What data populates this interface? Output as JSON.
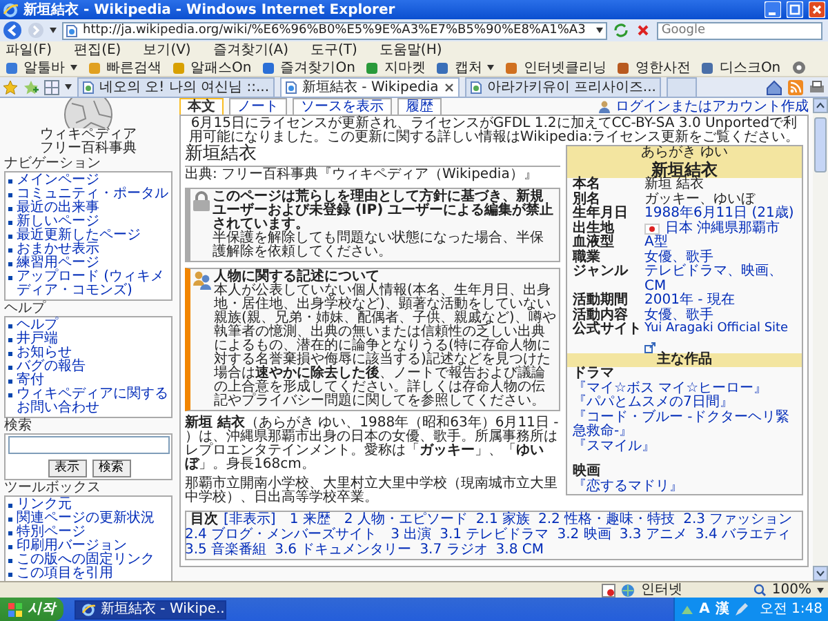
{
  "window": {
    "title": "新垣結衣 - Wikipedia - Windows Internet Explorer"
  },
  "address_bar": {
    "url": "http://ja.wikipedia.org/wiki/%E6%96%B0%E5%9E%A3%E7%B5%90%E8%A1%A3",
    "search_placeholder": "Google"
  },
  "menu": [
    "파일(F)",
    "편집(E)",
    "보기(V)",
    "즐겨찾기(A)",
    "도구(T)",
    "도움말(H)"
  ],
  "toolbar": [
    {
      "label": "알툴바",
      "dropdown": true
    },
    {
      "label": "빠른검색",
      "dropdown": false
    },
    {
      "label": "알패스On",
      "dropdown": false
    },
    {
      "label": "즐겨찾기On",
      "dropdown": false
    },
    {
      "label": "지마켓",
      "dropdown": false
    },
    {
      "label": "캡처",
      "dropdown": true
    },
    {
      "label": "인터넷클리닝",
      "dropdown": false
    },
    {
      "label": "영한사전",
      "dropdown": false
    },
    {
      "label": "디스크On",
      "dropdown": false
    }
  ],
  "tabs": [
    {
      "label": "네오의 오! 나의 여신님 ::...",
      "selected": false
    },
    {
      "label": "新垣結衣 - Wikipedia",
      "selected": true
    },
    {
      "label": "아라가키유이 프리사이즈...",
      "selected": false
    }
  ],
  "sidebar": {
    "logo_title": "ウィキペディア",
    "logo_subtitle": "フリー百科事典",
    "sections": [
      {
        "kind": "links",
        "heading": "ナビゲーション",
        "items": [
          "メインページ",
          "コミュニティ・ポータル",
          "最近の出来事",
          "新しいページ",
          "最近更新したページ",
          "おまかせ表示",
          "練習用ページ",
          "アップロード (ウィキメディア・コモンズ)"
        ]
      },
      {
        "kind": "links",
        "heading": "ヘルプ",
        "items": [
          "ヘルプ",
          "井戸端",
          "お知らせ",
          "バグの報告",
          "寄付",
          "ウィキペディアに関するお問い合わせ"
        ]
      },
      {
        "kind": "search",
        "heading": "検索",
        "buttons": [
          "表示",
          "検索"
        ]
      },
      {
        "kind": "links",
        "heading": "ツールボックス",
        "items": [
          "リンク元",
          "関連ページの更新状況",
          "特別ページ",
          "印刷用バージョン",
          "この版への固定リンク",
          "この項目を引用"
        ]
      }
    ]
  },
  "page": {
    "user_link": "ログインまたはアカウント作成",
    "page_tabs": [
      {
        "label": "本文",
        "selected": true
      },
      {
        "label": "ノート",
        "selected": false
      },
      {
        "label": "ソースを表示",
        "selected": false
      },
      {
        "label": "履歴",
        "selected": false
      }
    ],
    "site_notice": "6月15日にライセンスが更新され、ライセンスがGFDL 1.2に加えてCC-BY-SA 3.0 Unportedで利用可能になりました。この更新に関する詳しい情報はWikipedia:ライセンス更新をご覧ください。",
    "title": "新垣結衣",
    "subtitle": "出典: フリー百科事典『ウィキペディア（Wikipedia）』",
    "notices": [
      {
        "kind": "lock",
        "lines": [
          "**このページは荒らしを理由として方針に基づき、新規ユーザーおよび未登録 (IP) ユーザーによる編集が禁止されています。**",
          "半保護を解除しても問題ない状態になった場合、半保護解除を依頼してください。"
        ]
      },
      {
        "kind": "people",
        "lines": [
          "**人物に関する記述について**",
          "本人が公表していない個人情報(本名、生年月日、出身地・居住地、出身学校など)、顕著な活動をしていない親族(親、兄弟・姉妹、配偶者、子供、親戚など)、噂や執筆者の憶測、出典の無いまたは信頼性の乏しい出典によるもの、潜在的に論争となりうる(特に存命人物に対する名誉棄損や侮辱に該当する)記述などを見つけた場合は**速やかに除去した後**、ノートで報告および議論の上合意を形成してください。詳しくは存命人物の伝記やプライバシー問題に関してを参照してください。"
        ]
      }
    ],
    "paragraphs": [
      "**新垣 結衣**（あらがき ゆい、1988年（昭和63年）6月11日 - ）は、沖縄県那覇市出身の日本の女優、歌手。所属事務所はレプロエンタテインメント。愛称は「**ガッキー**」、「**ゆいぼ**」。身長168cm。",
      "那覇市立開南小学校、大里村立大里中学校（現南城市立大里中学校）、日出高等学校卒業。"
    ],
    "toc": {
      "title": "目次",
      "toggle": "[非表示]",
      "entries": [
        {
          "number": "1",
          "text": "来歴"
        },
        {
          "number": "2",
          "text": "人物・エピソード",
          "children": [
            {
              "number": "2.1",
              "text": "家族"
            },
            {
              "number": "2.2",
              "text": "性格・趣味・特技"
            },
            {
              "number": "2.3",
              "text": "ファッション"
            },
            {
              "number": "2.4",
              "text": "ブログ・メンバーズサイト"
            }
          ]
        },
        {
          "number": "3",
          "text": "出演",
          "children": [
            {
              "number": "3.1",
              "text": "テレビドラマ"
            },
            {
              "number": "3.2",
              "text": "映画"
            },
            {
              "number": "3.3",
              "text": "アニメ"
            },
            {
              "number": "3.4",
              "text": "バラエティ"
            },
            {
              "number": "3.5",
              "text": "音楽番組"
            },
            {
              "number": "3.6",
              "text": "ドキュメンタリー"
            },
            {
              "number": "3.7",
              "text": "ラジオ"
            },
            {
              "number": "3.8",
              "text": "CM"
            }
          ]
        }
      ]
    },
    "infobox": {
      "ruby": "あらがき ゆい",
      "name": "新垣結衣",
      "rows": [
        {
          "kind": "text",
          "label": "本名",
          "value": "新垣 結衣",
          "link": false
        },
        {
          "kind": "text",
          "label": "別名",
          "value": "ガッキー、ゆいぼ",
          "link": false
        },
        {
          "kind": "text",
          "label": "生年月日",
          "value": "1988年6月11日 (21歳)",
          "link": true
        },
        {
          "kind": "flag",
          "label": "出生地",
          "value": "日本 沖縄県那覇市",
          "link": true
        },
        {
          "kind": "text",
          "label": "血液型",
          "value": "A型",
          "link": true
        },
        {
          "kind": "text",
          "label": "職業",
          "value": "女優、歌手",
          "link": true
        },
        {
          "kind": "text",
          "label": "ジャンル",
          "value": "テレビドラマ、映画、CM",
          "link": true
        },
        {
          "kind": "text",
          "label": "活動期間",
          "value": "2001年 - 現在",
          "link": true
        },
        {
          "kind": "text",
          "label": "活動内容",
          "value": "女優、歌手",
          "link": true
        },
        {
          "kind": "external",
          "label": "公式サイト",
          "value": "Yui Aragaki Official Site",
          "link": true
        }
      ],
      "works_header": "主な作品",
      "works": [
        {
          "category": "ドラマ",
          "items": [
            "『マイ☆ボス マイ☆ヒーロー』",
            "『パパとムスメの7日間』",
            "『コード・ブルー -ドクターヘリ緊急救命-』",
            "『スマイル』"
          ]
        },
        {
          "category": "映画",
          "items": [
            "『恋するマドリ』"
          ]
        }
      ]
    }
  },
  "status_bar": {
    "zone": "인터넷",
    "zoom": "100%"
  },
  "taskbar": {
    "start": "시작",
    "windows": [
      {
        "label": "新垣結衣 - Wikipe...",
        "selected": true
      }
    ],
    "tray": [
      "A",
      "漢"
    ],
    "clock": "오전 1:48"
  }
}
